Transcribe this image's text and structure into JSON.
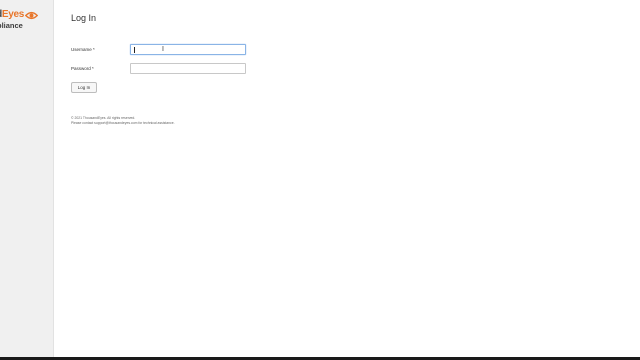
{
  "brand": {
    "name_part1": "and",
    "name_part2": "Eyes",
    "subtitle": "pliance",
    "logo_icon": "eye-icon",
    "accent_color": "#e8762b"
  },
  "page": {
    "title": "Log In"
  },
  "form": {
    "username_label": "Username *",
    "username_value": "",
    "password_label": "Password *",
    "password_value": "",
    "submit_label": "Log In"
  },
  "footer": {
    "copyright": "© 2021 ThousandEyes. All rights reserved.",
    "support": "Please contact support@thousandeyes.com for technical assistance."
  }
}
